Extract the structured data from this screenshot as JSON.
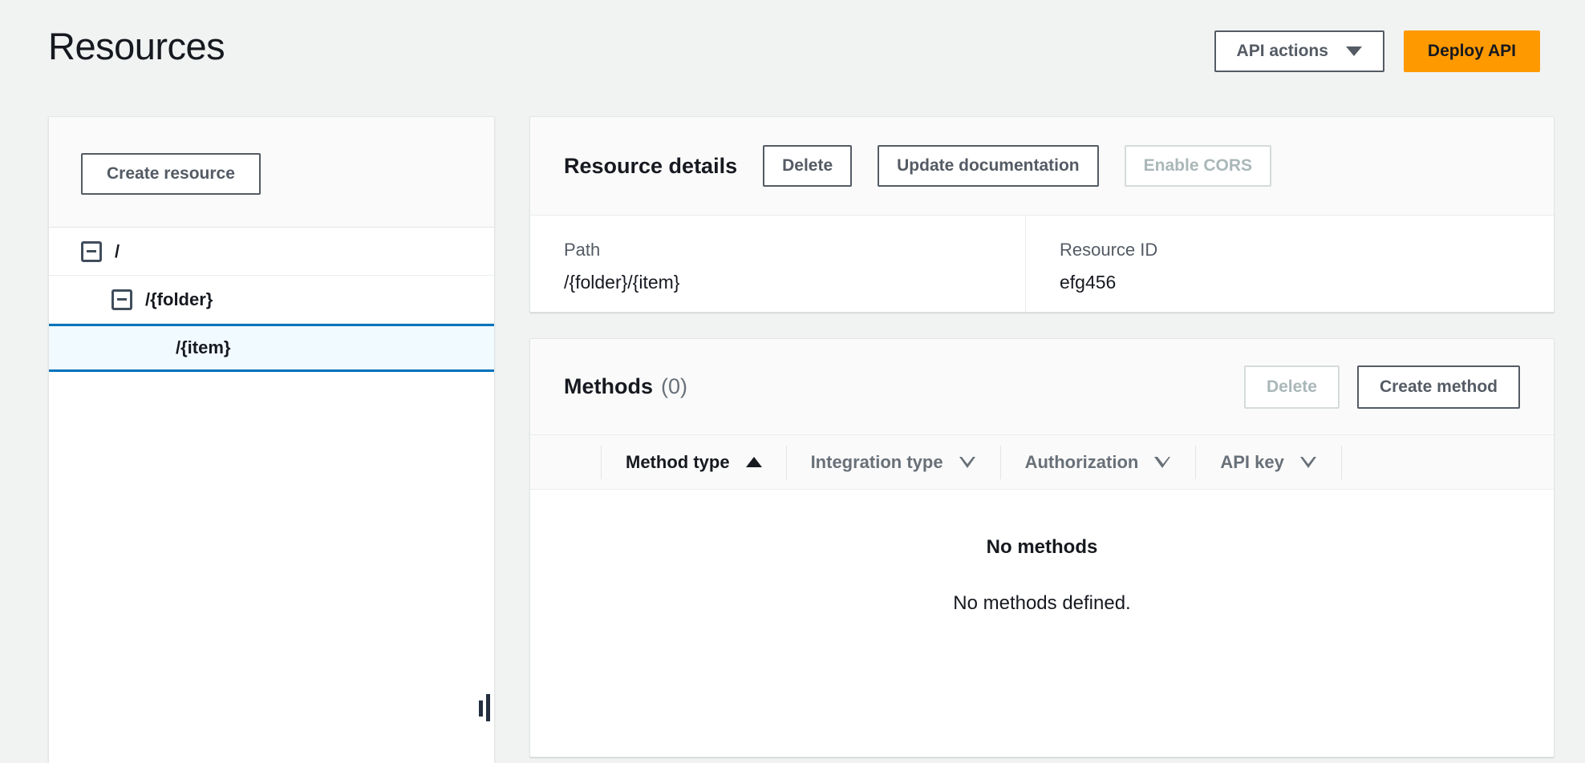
{
  "header": {
    "title": "Resources",
    "api_actions_label": "API actions",
    "api_actions_icon": "chevron-down-icon",
    "deploy_label": "Deploy API"
  },
  "colors": {
    "accent_orange": "#ff9900",
    "selected_blue": "#0073bb",
    "selected_row_bg": "#f1faff",
    "page_bg": "#f1f3f3",
    "border": "#e4e6e6",
    "muted_text": "#687078",
    "disabled_text": "#aab7b8"
  },
  "left_panel": {
    "create_resource_label": "Create resource",
    "tree": [
      {
        "label": "/",
        "level": 0,
        "expanded": true,
        "has_expander": true,
        "selected": false
      },
      {
        "label": "/{folder}",
        "level": 1,
        "expanded": true,
        "has_expander": true,
        "selected": false
      },
      {
        "label": "/{item}",
        "level": 2,
        "expanded": false,
        "has_expander": false,
        "selected": true
      }
    ],
    "resize_handle_name": "panel-resize-handle"
  },
  "resource_details": {
    "title": "Resource details",
    "buttons": [
      {
        "label": "Delete",
        "disabled": false
      },
      {
        "label": "Update documentation",
        "disabled": false
      },
      {
        "label": "Enable CORS",
        "disabled": true
      }
    ],
    "fields": [
      {
        "label": "Path",
        "value": "/{folder}/{item}"
      },
      {
        "label": "Resource ID",
        "value": "efg456"
      }
    ]
  },
  "methods": {
    "title": "Methods",
    "count": "(0)",
    "buttons": [
      {
        "label": "Delete",
        "disabled": true
      },
      {
        "label": "Create method",
        "disabled": false
      }
    ],
    "columns": [
      {
        "label": "Method type",
        "sort": "asc",
        "active": true
      },
      {
        "label": "Integration type",
        "sort": "desc",
        "active": false
      },
      {
        "label": "Authorization",
        "sort": "desc",
        "active": false
      },
      {
        "label": "API key",
        "sort": "desc",
        "active": false
      }
    ],
    "empty_title": "No methods",
    "empty_description": "No methods defined."
  }
}
